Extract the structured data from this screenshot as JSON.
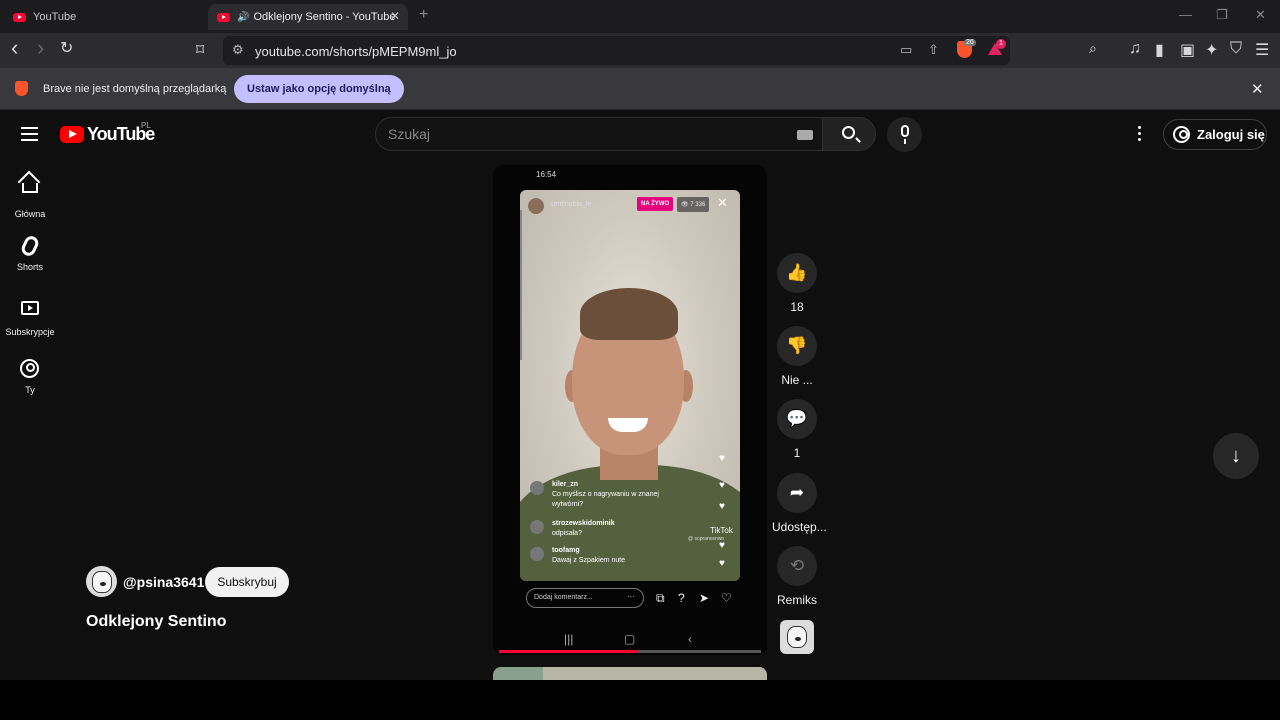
{
  "browser": {
    "tabs": [
      {
        "title": "YouTube",
        "active": false
      },
      {
        "title": "Odklejony Sentino - YouTube",
        "active": true
      }
    ],
    "tab_close": "✕",
    "new_tab": "+",
    "window_controls": {
      "minimize": "—",
      "maximize": "❐",
      "close": "✕"
    },
    "url": "youtube.com/shorts/pMEPM9ml_jo",
    "toolbar_icons": {
      "back": "‹",
      "forward": "›",
      "reload": "↻",
      "bookmark": "⌑",
      "site_info": "⚙",
      "cast": "▭",
      "share": "⇧",
      "wallet": "▣",
      "leo": "✦",
      "vpn": "⛉",
      "menu": "☰",
      "sidebar": "▮",
      "music": "♫",
      "search_tabs": "⌕"
    },
    "brave_badge": "26",
    "rewards_badge": "1"
  },
  "infobar": {
    "message": "Brave nie jest domyślną przeglądarką",
    "button": "Ustaw jako opcję domyślną",
    "close": "✕"
  },
  "header": {
    "logo_text": "YouTube",
    "country": "PL",
    "search_placeholder": "Szukaj",
    "signin": "Zaloguj się"
  },
  "sidebar": {
    "items": [
      {
        "label": "Główna",
        "icon": "home-icon"
      },
      {
        "label": "Shorts",
        "icon": "shorts-icon"
      },
      {
        "label": "Subskrypcje",
        "icon": "subscriptions-icon"
      },
      {
        "label": "Ty",
        "icon": "you-icon"
      }
    ]
  },
  "video": {
    "status_time": "16:54",
    "live_user": "sentinobla_le",
    "live_badge": "NA ŻYWO",
    "viewers": "👁 7 336",
    "live_close": "✕",
    "comments": [
      {
        "user": "kiler_zn",
        "text": "Co myślisz o nagrywaniu w znanej wytwórni?"
      },
      {
        "user": "strozewskidominik",
        "text": "odpisała?"
      },
      {
        "user": "toofamg",
        "text": "Dawaj z Szpakiem nute"
      }
    ],
    "watermark": "TikTok",
    "watermark_sub": "@ sopranosnwn",
    "comment_placeholder": "Dodaj komentarz...",
    "comment_dots": "···",
    "progress": 0.53
  },
  "actions": {
    "like": {
      "icon": "👍",
      "label": "18"
    },
    "dislike": {
      "icon": "👎",
      "label": "Nie ..."
    },
    "comments": {
      "icon": "💬",
      "label": "1"
    },
    "share": {
      "icon": "➦",
      "label": "Udostęp..."
    },
    "remix": {
      "icon": "⟲",
      "label": "Remiks"
    }
  },
  "channel": {
    "handle": "@psina3641",
    "subscribe": "Subskrybuj"
  },
  "title": "Odklejony Sentino",
  "next_button": "↓",
  "colors": {
    "accent": "#ff0033",
    "infobar_button": "#c4c0ff",
    "live_badge": "#e6007e",
    "brave_orange": "#fb542b"
  }
}
